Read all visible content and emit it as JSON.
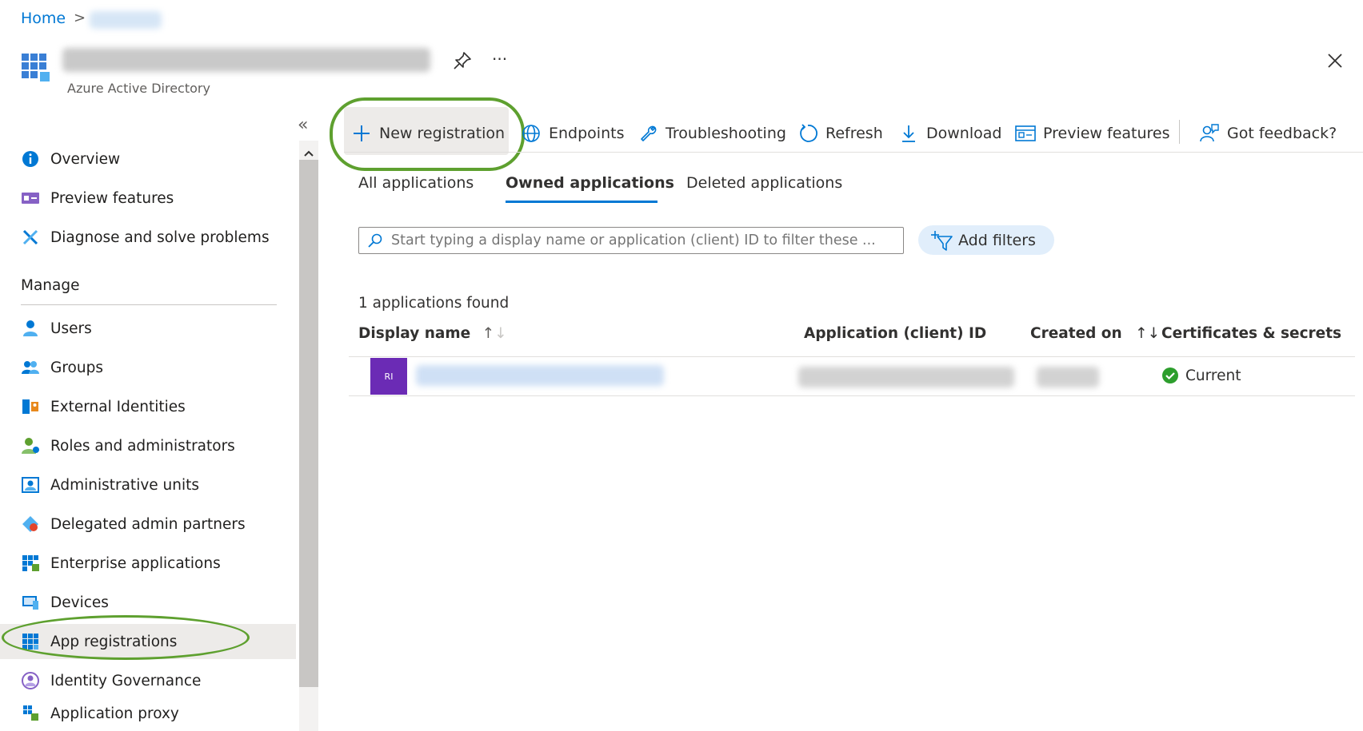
{
  "breadcrumb": {
    "home": "Home",
    "separator": ">"
  },
  "header": {
    "subtitle": "Azure Active Directory",
    "more": "···"
  },
  "sidebar": {
    "collapse": "«",
    "top_items": [
      {
        "label": "Overview",
        "icon": "info-icon"
      },
      {
        "label": "Preview features",
        "icon": "preview-features-icon"
      },
      {
        "label": "Diagnose and solve problems",
        "icon": "wrench-icon"
      }
    ],
    "section_title": "Manage",
    "manage_items": [
      {
        "label": "Users",
        "icon": "user-icon"
      },
      {
        "label": "Groups",
        "icon": "group-icon"
      },
      {
        "label": "External Identities",
        "icon": "external-identities-icon"
      },
      {
        "label": "Roles and administrators",
        "icon": "roles-icon"
      },
      {
        "label": "Administrative units",
        "icon": "admin-units-icon"
      },
      {
        "label": "Delegated admin partners",
        "icon": "partners-icon"
      },
      {
        "label": "Enterprise applications",
        "icon": "enterprise-apps-icon"
      },
      {
        "label": "Devices",
        "icon": "devices-icon"
      },
      {
        "label": "App registrations",
        "icon": "app-registrations-icon",
        "active": true
      },
      {
        "label": "Identity Governance",
        "icon": "identity-governance-icon"
      },
      {
        "label": "Application proxy",
        "icon": "application-proxy-icon"
      }
    ]
  },
  "toolbar": {
    "new_registration": "New registration",
    "endpoints": "Endpoints",
    "troubleshooting": "Troubleshooting",
    "refresh": "Refresh",
    "download": "Download",
    "preview_features": "Preview features",
    "feedback": "Got feedback?"
  },
  "tabs": [
    {
      "label": "All applications"
    },
    {
      "label": "Owned applications",
      "active": true
    },
    {
      "label": "Deleted applications"
    }
  ],
  "search": {
    "placeholder": "Start typing a display name or application (client) ID to filter these ..."
  },
  "add_filters": "Add filters",
  "results_count": "1 applications found",
  "table": {
    "columns": [
      "Display name",
      "Application (client) ID",
      "Created on",
      "Certificates & secrets"
    ],
    "rows": [
      {
        "avatar": "RI",
        "certificates": "Current"
      }
    ]
  },
  "colors": {
    "accent": "#0078d4",
    "highlight": "#5ea02f",
    "avatar": "#6b2bb5",
    "success": "#2d9e2d"
  }
}
